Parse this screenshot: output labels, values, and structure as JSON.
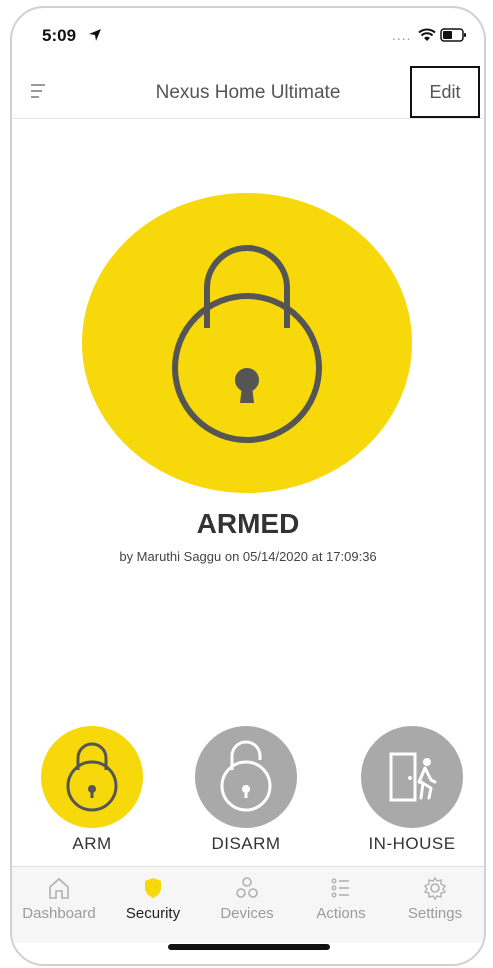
{
  "status_bar": {
    "time": "5:09",
    "signal_dots": "...."
  },
  "nav": {
    "title": "Nexus Home Ultimate",
    "edit_label": "Edit"
  },
  "security_status": {
    "state": "ARMED",
    "detail": "by Maruthi Saggu on 05/14/2020 at 17:09:36"
  },
  "modes": [
    {
      "label": "ARM",
      "icon": "lock-closed-icon",
      "active": true
    },
    {
      "label": "DISARM",
      "icon": "lock-open-icon",
      "active": false
    },
    {
      "label": "IN-HOUSE",
      "icon": "person-door-icon",
      "active": false
    }
  ],
  "tabs": [
    {
      "label": "Dashboard",
      "icon": "home-icon",
      "active": false
    },
    {
      "label": "Security",
      "icon": "shield-icon",
      "active": true
    },
    {
      "label": "Devices",
      "icon": "devices-icon",
      "active": false
    },
    {
      "label": "Actions",
      "icon": "list-icon",
      "active": false
    },
    {
      "label": "Settings",
      "icon": "gear-icon",
      "active": false
    }
  ],
  "colors": {
    "accent": "#f7d80a",
    "inactive": "#a9a9a9",
    "lock_stroke": "#555555"
  }
}
